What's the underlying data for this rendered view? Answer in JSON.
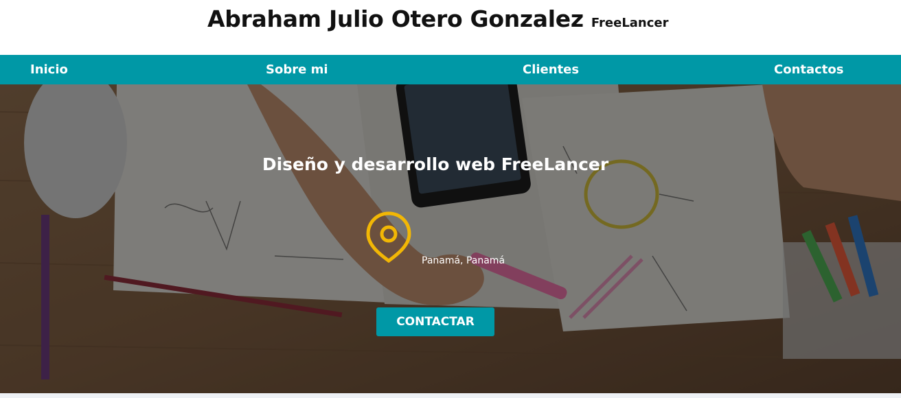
{
  "header": {
    "name": "Abraham Julio Otero Gonzalez",
    "tagline": "FreeLancer"
  },
  "nav": {
    "items": [
      {
        "label": "Inicio"
      },
      {
        "label": "Sobre mi"
      },
      {
        "label": "Clientes"
      },
      {
        "label": "Contactos"
      }
    ]
  },
  "hero": {
    "title": "Diseño y desarrollo web FreeLancer",
    "location": "Panamá, Panamá",
    "cta_label": "CONTACTAR",
    "pin_icon": "map-pin-icon"
  },
  "colors": {
    "accent": "#0098a6",
    "pin": "#f2b705",
    "header_bg": "#ffffff",
    "hero_text": "#ffffff"
  }
}
